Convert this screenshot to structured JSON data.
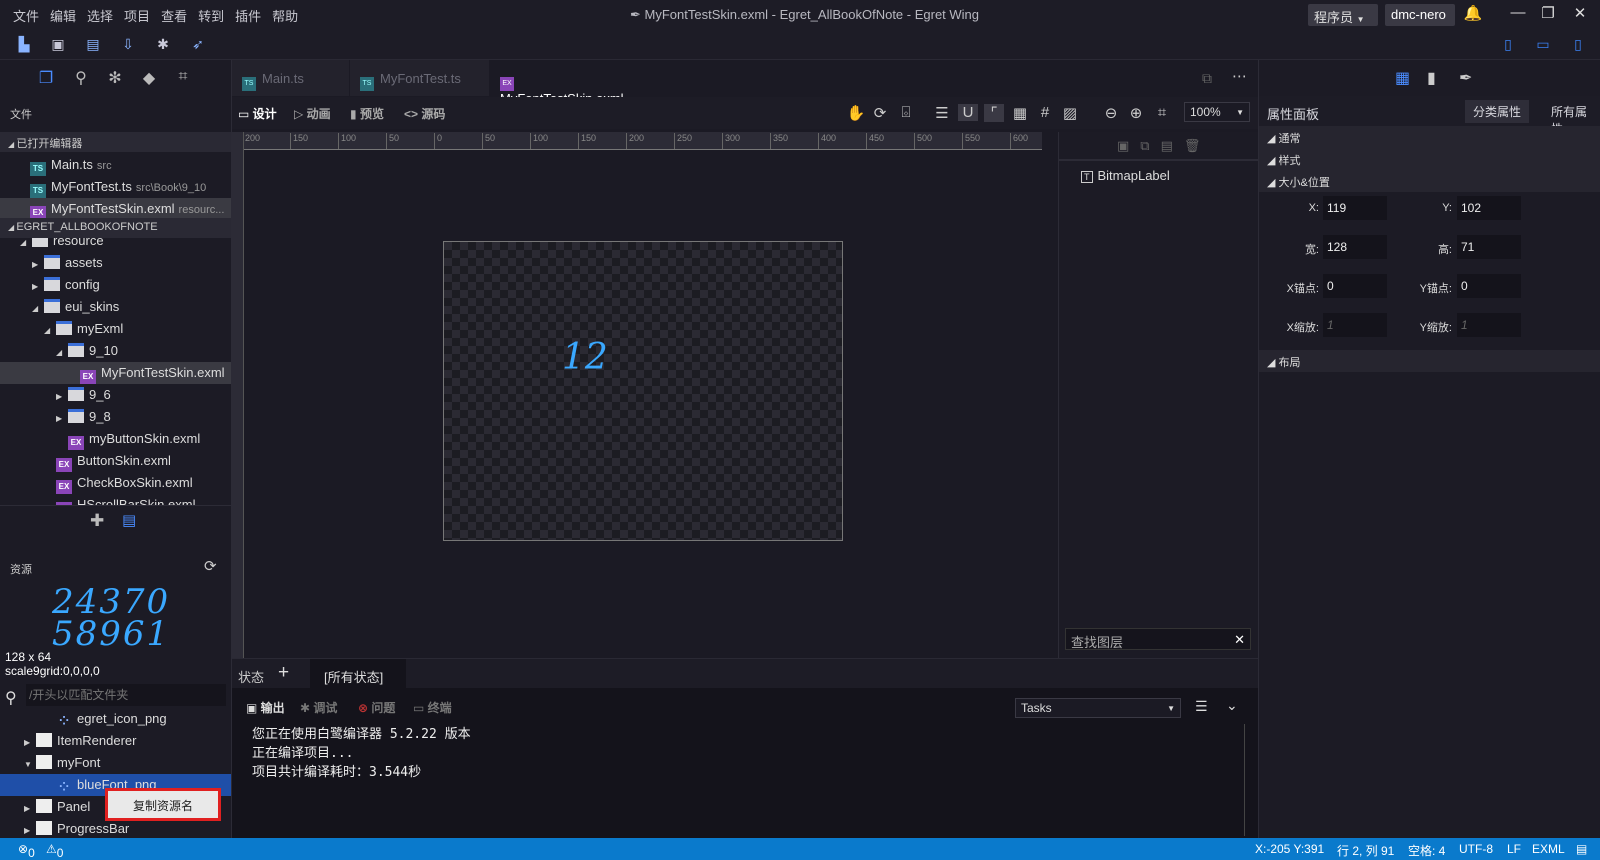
{
  "titlebar": {
    "menu": [
      "文件",
      "编辑",
      "选择",
      "项目",
      "查看",
      "转到",
      "插件",
      "帮助"
    ],
    "title": "MyFontTestSkin.exml - Egret_AllBookOfNote - Egret Wing",
    "role": "程序员",
    "user": "dmc-nero"
  },
  "left": {
    "files_label": "文件",
    "open_editors_label": "已打开编辑器",
    "open_editors": [
      {
        "name": "Main.ts",
        "hint": "src",
        "type": "ts"
      },
      {
        "name": "MyFontTest.ts",
        "hint": "src\\Book\\9_10",
        "type": "ts"
      },
      {
        "name": "MyFontTestSkin.exml",
        "hint": "resourc...",
        "type": "ex",
        "selected": true
      }
    ],
    "project_label": "EGRET_ALLBOOKOFNOTE",
    "tree": [
      {
        "name": "resource",
        "lvl": 1,
        "type": "folder",
        "arrow": "◢"
      },
      {
        "name": "assets",
        "lvl": 2,
        "type": "folder",
        "arrow": "▶"
      },
      {
        "name": "config",
        "lvl": 2,
        "type": "folder",
        "arrow": "▶"
      },
      {
        "name": "eui_skins",
        "lvl": 2,
        "type": "folder",
        "arrow": "◢"
      },
      {
        "name": "myExml",
        "lvl": 3,
        "type": "folder",
        "arrow": "◢"
      },
      {
        "name": "9_10",
        "lvl": 4,
        "type": "folder",
        "arrow": "◢"
      },
      {
        "name": "MyFontTestSkin.exml",
        "lvl": 5,
        "type": "ex",
        "selected": true
      },
      {
        "name": "9_6",
        "lvl": 4,
        "type": "folder",
        "arrow": "▶"
      },
      {
        "name": "9_8",
        "lvl": 4,
        "type": "folder",
        "arrow": "▶"
      },
      {
        "name": "myButtonSkin.exml",
        "lvl": 4,
        "type": "ex"
      },
      {
        "name": "ButtonSkin.exml",
        "lvl": 3,
        "type": "ex"
      },
      {
        "name": "CheckBoxSkin.exml",
        "lvl": 3,
        "type": "ex"
      },
      {
        "name": "HScrollBarSkin.exml",
        "lvl": 3,
        "type": "ex"
      }
    ],
    "resources_label": "资源",
    "preview_line1": "24370",
    "preview_line2": "58961",
    "preview_size": "128 x 64",
    "preview_scale9": "scale9grid:0,0,0,0",
    "search_placeholder": "/开头以匹配文件夹",
    "res_tree": [
      {
        "name": "egret_icon_png",
        "lvl": 2
      },
      {
        "name": "ItemRenderer",
        "lvl": 1,
        "arrow": "▶"
      },
      {
        "name": "myFont",
        "lvl": 1,
        "arrow": "▼"
      },
      {
        "name": "blueFont_png",
        "lvl": 2,
        "selected": true
      },
      {
        "name": "Panel",
        "lvl": 1,
        "arrow": "▶"
      },
      {
        "name": "ProgressBar",
        "lvl": 1,
        "arrow": "▶"
      }
    ],
    "context_menu": "复制资源名"
  },
  "editor": {
    "tabs": [
      {
        "name": "Main.ts",
        "type": "ts"
      },
      {
        "name": "MyFontTest.ts",
        "type": "ts"
      },
      {
        "name": "MyFontTestSkin.exml",
        "type": "ex",
        "active": true
      }
    ],
    "modes": [
      "设计",
      "动画",
      "预览",
      "<> 源码"
    ],
    "zoom": "100%",
    "ruler": [
      "200",
      "150",
      "100",
      "50",
      "0",
      "50",
      "100",
      "150",
      "200",
      "250",
      "300",
      "350",
      "400",
      "450",
      "500",
      "550",
      "600"
    ],
    "canvas_text": "12",
    "layer": "BitmapLabel",
    "layer_search": "查找图层",
    "state_label": "状态",
    "state_add": "+",
    "state_all": "[所有状态]",
    "output_tabs": [
      "输出",
      "调试",
      "问题",
      "终端"
    ],
    "tasks": "Tasks",
    "log": [
      "您正在使用白鹭编译器 5.2.22 版本",
      "正在编译项目...",
      "项目共计编译耗时：3.544秒"
    ]
  },
  "props": {
    "title": "属性面板",
    "tab_category": "分类属性",
    "tab_all": "所有属性",
    "sections": [
      "通常",
      "样式",
      "大小&位置"
    ],
    "layout_section": "布局",
    "fields": [
      {
        "l1": "X:",
        "v1": "119",
        "l2": "Y:",
        "v2": "102"
      },
      {
        "l1": "宽:",
        "v1": "128",
        "l2": "高:",
        "v2": "71"
      },
      {
        "l1": "X锚点:",
        "v1": "0",
        "l2": "Y锚点:",
        "v2": "0"
      },
      {
        "l1": "X缩放:",
        "v1": "1",
        "l2": "Y缩放:",
        "v2": "1",
        "dim": true
      }
    ]
  },
  "status": {
    "errors": "0",
    "warnings": "0",
    "coords": "X:-205 Y:391",
    "position": "行 2, 列 91",
    "spaces": "空格: 4",
    "encoding": "UTF-8",
    "eol": "LF",
    "language": "EXML"
  },
  "colors": {
    "accent": "#0a7acc",
    "highlight": "#1f4fa8",
    "context_border": "#e02020"
  }
}
